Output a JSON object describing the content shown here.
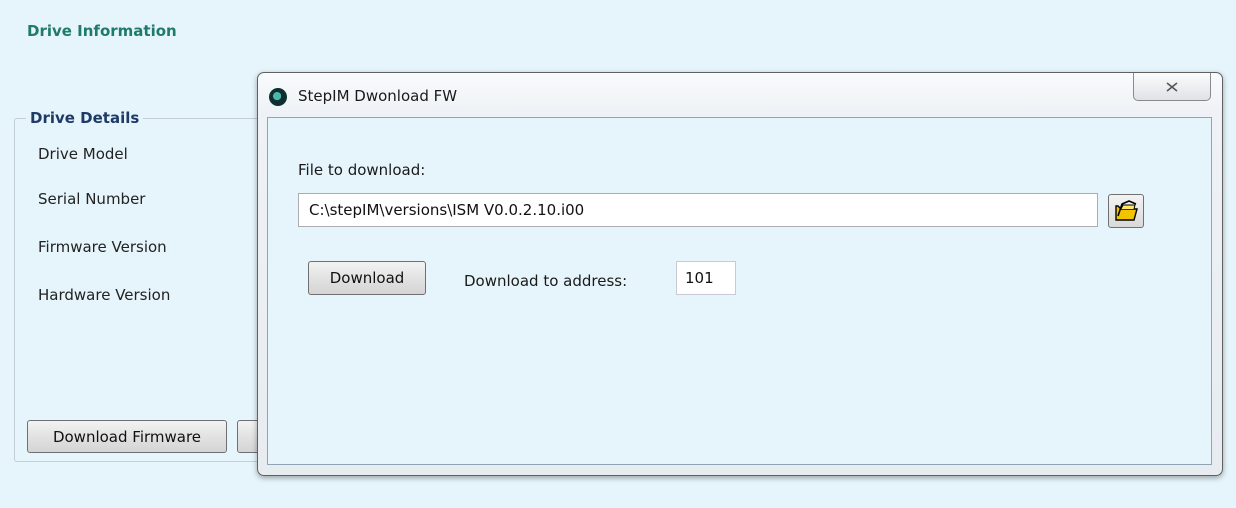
{
  "app": {
    "title": "Drive Information"
  },
  "drive_details": {
    "group_title": "Drive Details",
    "labels": [
      "Drive Model",
      "Serial Number",
      "Firmware Version",
      "Hardware Version"
    ],
    "download_firmware_label": "Download Firmware"
  },
  "dialog": {
    "title": "StepIM Dwonload FW",
    "file_label": "File to download:",
    "file_path": "C:\\stepIM\\versions\\ISM V0.0.2.10.i00",
    "download_label": "Download",
    "address_label": "Download to address:",
    "address_value": "101",
    "icons": {
      "app": "steppim-logo-icon",
      "close": "close-icon",
      "browse": "folder-icon"
    }
  },
  "colors": {
    "background": "#e6f5fc",
    "title_teal": "#1f7a6b",
    "group_title_navy": "#1e3a66"
  }
}
